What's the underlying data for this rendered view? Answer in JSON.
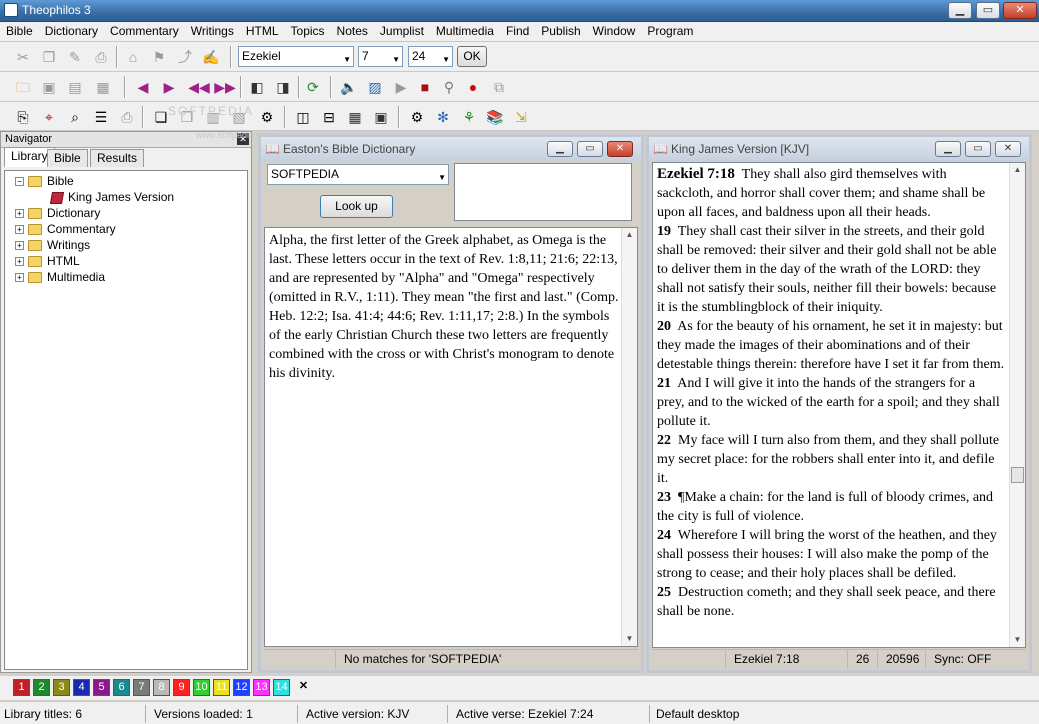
{
  "app": {
    "title": "Theophilos 3"
  },
  "menu": [
    "Bible",
    "Dictionary",
    "Commentary",
    "Writings",
    "HTML",
    "Topics",
    "Notes",
    "Jumplist",
    "Multimedia",
    "Find",
    "Publish",
    "Window",
    "Program"
  ],
  "nav_toolbar": {
    "book": "Ezekiel",
    "chapter": "7",
    "verse": "24",
    "ok_label": "OK"
  },
  "navigator": {
    "title": "Navigator",
    "close_glyph": "✕",
    "tabs": [
      "Library",
      "Bible",
      "Results"
    ],
    "tree": [
      {
        "label": "Bible",
        "expanded": true,
        "children": [
          "King James Version"
        ]
      },
      {
        "label": "Dictionary"
      },
      {
        "label": "Commentary"
      },
      {
        "label": "Writings"
      },
      {
        "label": "HTML"
      },
      {
        "label": "Multimedia"
      }
    ]
  },
  "dictionary": {
    "title": "Easton's Bible Dictionary",
    "search_value": "SOFTPEDIA",
    "lookup_label": "Look up",
    "text": "Alpha, the first letter of the Greek alphabet, as Omega is the last. These letters occur in the text of Rev. 1:8,11; 21:6; 22:13, and are represented by \"Alpha\" and \"Omega\" respectively (omitted in R.V., 1:11). They mean \"the first and last.\" (Comp. Heb. 12:2; Isa. 41:4; 44:6; Rev. 1:11,17; 2:8.) In the symbols of the early Christian Church these two letters are frequently combined with the cross or with Christ's monogram to denote his divinity.",
    "status": "No matches for 'SOFTPEDIA'"
  },
  "bible": {
    "title": "King James Version [KJV]",
    "verses": [
      {
        "ref": "Ezekiel 7:18",
        "text": "They shall also gird themselves with sackcloth, and horror shall cover them; and shame shall be upon all faces, and baldness upon all their heads."
      },
      {
        "ref": "19",
        "text": "They shall cast their silver in the streets, and their gold shall be removed: their silver and their gold shall not be able to deliver them in the day of the wrath of the LORD: they shall not satisfy their souls, neither fill their bowels: because it is the stumblingblock of their iniquity."
      },
      {
        "ref": "20",
        "text": "As for the beauty of his ornament, he set it in majesty: but they made the images of their abominations and of their detestable things therein: therefore have I set it far from them."
      },
      {
        "ref": "21",
        "text": "And I will give it into the hands of the strangers for a prey, and to the wicked of the earth for a spoil; and they shall pollute it."
      },
      {
        "ref": "22",
        "text": "My face will I turn also from them, and they shall pollute my secret place: for the robbers shall enter into it, and defile it."
      },
      {
        "ref": "23",
        "text": "¶Make a chain: for the land is full of bloody crimes, and the city is full of violence."
      },
      {
        "ref": "24",
        "text": "Wherefore I will bring the worst of the heathen, and they shall possess their houses: I will also make the pomp of the strong to cease; and their holy places shall be defiled."
      },
      {
        "ref": "25",
        "text": "Destruction cometh; and they shall seek peace, and there shall be none."
      }
    ],
    "status": {
      "ref": "Ezekiel 7:18",
      "chapter_count": "26",
      "number": "20596",
      "sync": "Sync: OFF"
    }
  },
  "color_tabs": [
    {
      "label": "1",
      "color": "#c0202a"
    },
    {
      "label": "2",
      "color": "#1e8a2e"
    },
    {
      "label": "3",
      "color": "#8a8a1a"
    },
    {
      "label": "4",
      "color": "#1a2ab0"
    },
    {
      "label": "5",
      "color": "#8a1a8a"
    },
    {
      "label": "6",
      "color": "#1a8a8a"
    },
    {
      "label": "7",
      "color": "#7a7a7a"
    },
    {
      "label": "8",
      "color": "#b8b8b8"
    },
    {
      "label": "9",
      "color": "#ff2020"
    },
    {
      "label": "10",
      "color": "#30d030"
    },
    {
      "label": "11",
      "color": "#e8e020"
    },
    {
      "label": "12",
      "color": "#2040ff"
    },
    {
      "label": "13",
      "color": "#ff30ff"
    },
    {
      "label": "14",
      "color": "#30e0e0"
    }
  ],
  "color_close": "✕",
  "statusbar": {
    "library_titles": "Library titles: 6",
    "versions_loaded": "Versions loaded: 1",
    "active_version": "Active version: KJV",
    "active_verse": "Active verse: Ezekiel 7:24",
    "desktop": "Default desktop"
  },
  "watermark": "SOFTPEDIA",
  "watermark_url": "www.softpedia.com"
}
